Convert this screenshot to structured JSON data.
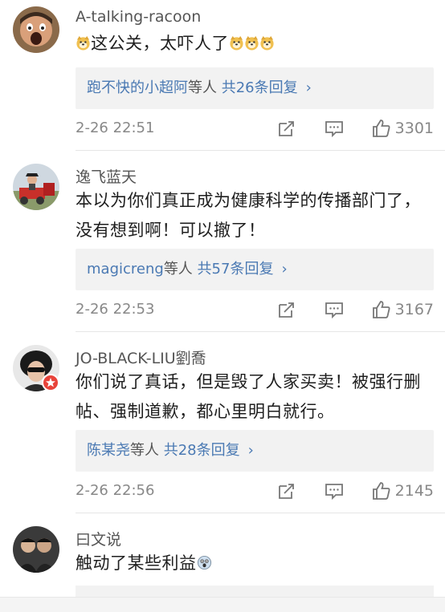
{
  "comments": [
    {
      "username": "A-talking-racoon",
      "text_pre": "",
      "text_main": "这公关，太吓人了",
      "replies": {
        "names": "跑不快的小超阿",
        "suffix": "等人",
        "count": "共26条回复"
      },
      "time": "2-26 22:51",
      "likes": "3301"
    },
    {
      "username": "逸飞蓝天",
      "text": "本以为你们真正成为健康科学的传播部门了，没有想到啊！可以撤了！",
      "replies": {
        "names": "magicreng",
        "suffix": "等人",
        "count": "共57条回复"
      },
      "time": "2-26 22:53",
      "likes": "3167"
    },
    {
      "username": "JO-BLACK-LIU劉喬",
      "text": "你们说了真话，但是毁了人家买卖！被强行删帖、强制道歉，都心里明白就行。",
      "replies": {
        "names": "陈某尧",
        "suffix": "等人",
        "count": "共28条回复"
      },
      "time": "2-26 22:56",
      "likes": "2145"
    },
    {
      "username": "曰文说",
      "text": "触动了某些利益"
    }
  ],
  "icons": {
    "repost": "repost-icon",
    "comment": "comment-icon",
    "like": "thumbs-up-icon",
    "chevron": "chevron-right-icon",
    "emoji_doge": "doge-emoji-icon",
    "emoji_shock": "shocked-emoji-icon"
  },
  "colors": {
    "link": "#4a79b3",
    "meta": "#888888",
    "reply_bg": "#f2f2f2",
    "badge": "#e8433a"
  }
}
